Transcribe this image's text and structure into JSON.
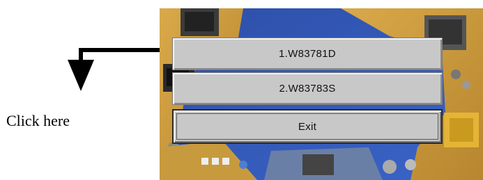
{
  "annotation": {
    "caption": "Click here"
  },
  "menu": {
    "items": [
      {
        "label": "1.W83781D"
      },
      {
        "label": "2.W83783S"
      },
      {
        "label": "Exit"
      }
    ]
  },
  "colors": {
    "button_face": "#c8c8c8",
    "board_blue": "#2f56b7",
    "board_yellow": "#d6a63e"
  },
  "icons": {
    "arrow": "down-arrow-icon",
    "board": "motherboard-image"
  }
}
